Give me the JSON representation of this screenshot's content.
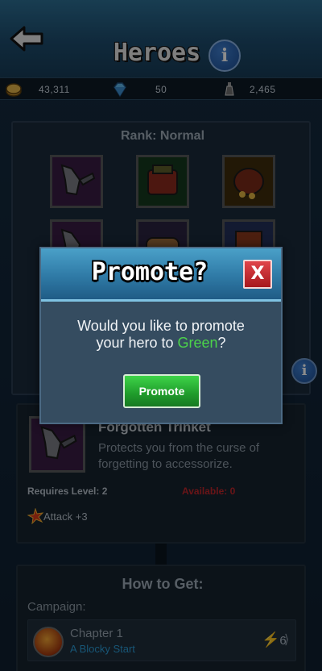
{
  "header": {
    "title": "Heroes"
  },
  "currencies": [
    {
      "icon": "gold-coins-icon",
      "value": "43,311"
    },
    {
      "icon": "gem-icon",
      "value": "50"
    },
    {
      "icon": "potion-icon",
      "value": "2,465"
    }
  ],
  "equipment": {
    "rank_label": "Rank: Normal",
    "slots": [
      "gauntlet-item-icon",
      "backpack-item-icon",
      "pouch-item-icon",
      "gauntlet-item-icon",
      "scroll-item-icon",
      "book-item-icon"
    ]
  },
  "item": {
    "name": "Forgotten Trinket",
    "description": "Protects you from the curse of forgetting to accessorize.",
    "requires_level": "Requires Level: 2",
    "available": "Available: 0",
    "stat": "Attack +3"
  },
  "how_to_get": {
    "title": "How to Get:",
    "campaign_label": "Campaign:",
    "chapter_title": "Chapter 1",
    "chapter_subtitle": "A Blocky Start",
    "energy_cost": "6"
  },
  "modal": {
    "title": "Promote?",
    "close_label": "X",
    "message_line1": "Would you like to promote",
    "message_prefix": "your hero to ",
    "message_highlight": "Green",
    "message_suffix": "?",
    "button_label": "Promote"
  },
  "colors": {
    "accent_green": "#4cd34a",
    "close_red": "#c8252b",
    "available_red": "#c0262b",
    "link_blue": "#2b9cd6"
  }
}
